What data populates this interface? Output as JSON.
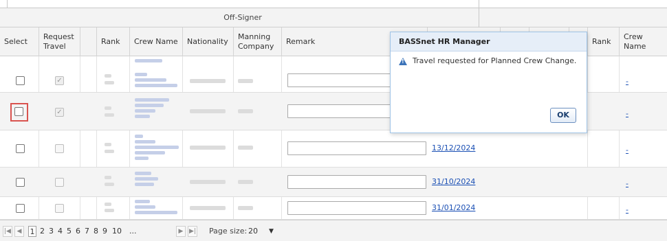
{
  "grid": {
    "group_title": "Off-Signer",
    "columns": [
      {
        "key": "select",
        "label": "Select"
      },
      {
        "key": "request_travel",
        "label": "Request Travel"
      },
      {
        "key": "blank",
        "label": ""
      },
      {
        "key": "rank",
        "label": "Rank"
      },
      {
        "key": "crew_name",
        "label": "Crew Name"
      },
      {
        "key": "nationality",
        "label": "Nationality"
      },
      {
        "key": "manning_company",
        "label": "Manning Company"
      },
      {
        "key": "remark",
        "label": "Remark"
      },
      {
        "key": "rank_on",
        "label": "Rank"
      },
      {
        "key": "crew_name_on",
        "label": "Crew Name"
      }
    ],
    "rows": [
      {
        "date": "",
        "on_signer_link": "-",
        "request_travel_checked": true
      },
      {
        "date": "",
        "on_signer_link": "-",
        "request_travel_checked": true,
        "highlighted": true
      },
      {
        "date": "13/12/2024",
        "on_signer_link": "-",
        "request_travel_checked": false
      },
      {
        "date": "31/10/2024",
        "on_signer_link": "-",
        "request_travel_checked": false
      },
      {
        "date": "31/01/2024",
        "on_signer_link": "-",
        "request_travel_checked": false
      }
    ]
  },
  "pager": {
    "pages": [
      "1",
      "2",
      "3",
      "4",
      "5",
      "6",
      "7",
      "8",
      "9",
      "10",
      "..."
    ],
    "current_page": "1",
    "page_size_label": "Page size:",
    "page_size_value": "20"
  },
  "dialog": {
    "title": "BASSnet HR Manager",
    "message": "Travel requested for Planned Crew Change.",
    "ok_label": "OK"
  },
  "colors": {
    "link": "#1a4fb4",
    "highlight": "#d9534f",
    "dialog_border": "#9fc3e6",
    "dialog_title_bg": "#e6eef8"
  },
  "icons": {
    "first_page": "first-page-icon",
    "prev_page": "prev-page-icon",
    "next_page": "next-page-icon",
    "last_page": "last-page-icon",
    "dialog_alert": "warning-icon",
    "dropdown": "chevron-down-icon"
  }
}
